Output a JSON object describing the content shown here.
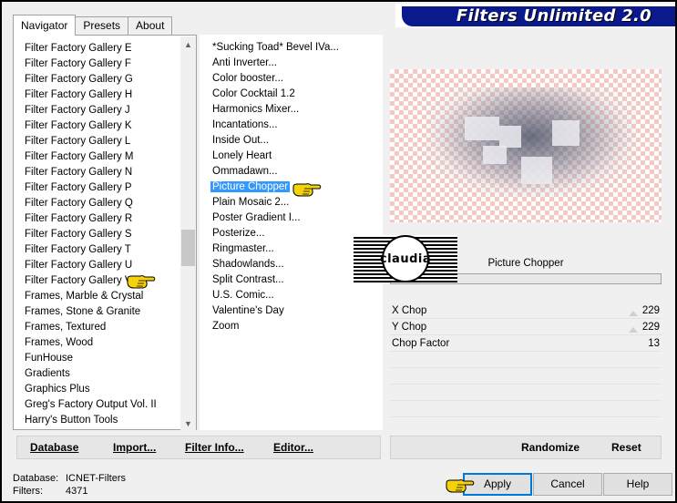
{
  "window": {
    "title": "Filters Unlimited 2.0"
  },
  "tabs": [
    {
      "label": "Navigator",
      "active": true
    },
    {
      "label": "Presets",
      "active": false
    },
    {
      "label": "About",
      "active": false
    }
  ],
  "categories": {
    "items": [
      "Filter Factory Gallery E",
      "Filter Factory Gallery F",
      "Filter Factory Gallery G",
      "Filter Factory Gallery H",
      "Filter Factory Gallery J",
      "Filter Factory Gallery K",
      "Filter Factory Gallery L",
      "Filter Factory Gallery M",
      "Filter Factory Gallery N",
      "Filter Factory Gallery P",
      "Filter Factory Gallery Q",
      "Filter Factory Gallery R",
      "Filter Factory Gallery S",
      "Filter Factory Gallery T",
      "Filter Factory Gallery U",
      "Filter Factory Gallery V",
      "Frames, Marble & Crystal",
      "Frames, Stone & Granite",
      "Frames, Textured",
      "Frames, Wood",
      "FunHouse",
      "Gradients",
      "Graphics Plus",
      "Greg's Factory Output Vol. II",
      "Harry's Button Tools"
    ],
    "selected_index": 15
  },
  "filters": {
    "items": [
      "*Sucking Toad*  Bevel IVa...",
      "Anti Inverter...",
      "Color booster...",
      "Color Cocktail 1.2",
      "Harmonics Mixer...",
      "Incantations...",
      "Inside Out...",
      "Lonely Heart",
      "Ommadawn...",
      "Picture Chopper",
      "Plain Mosaic 2...",
      "Poster Gradient I...",
      "Posterize...",
      "Ringmaster...",
      "Shadowlands...",
      "Split Contrast...",
      "U.S. Comic...",
      "Valentine's Day",
      "Zoom"
    ],
    "selected_index": 9
  },
  "preview": {
    "filter_name": "Picture Chopper"
  },
  "parameters": [
    {
      "name": "X Chop",
      "value": "229"
    },
    {
      "name": "Y Chop",
      "value": "229"
    },
    {
      "name": "Chop Factor",
      "value": "13"
    }
  ],
  "watermark": {
    "text": "claudia"
  },
  "left_actions": {
    "database": "Database",
    "import": "Import...",
    "filter_info": "Filter Info...",
    "editor": "Editor..."
  },
  "right_actions": {
    "randomize": "Randomize",
    "reset": "Reset"
  },
  "status": {
    "database_label": "Database:",
    "database_value": "ICNET-Filters",
    "filters_label": "Filters:",
    "filters_value": "4371"
  },
  "buttons": {
    "apply": "Apply",
    "cancel": "Cancel",
    "help": "Help"
  },
  "colors": {
    "banner": "#0a1a8c",
    "selection": "#3399ff",
    "hand": "#f5d20a"
  }
}
